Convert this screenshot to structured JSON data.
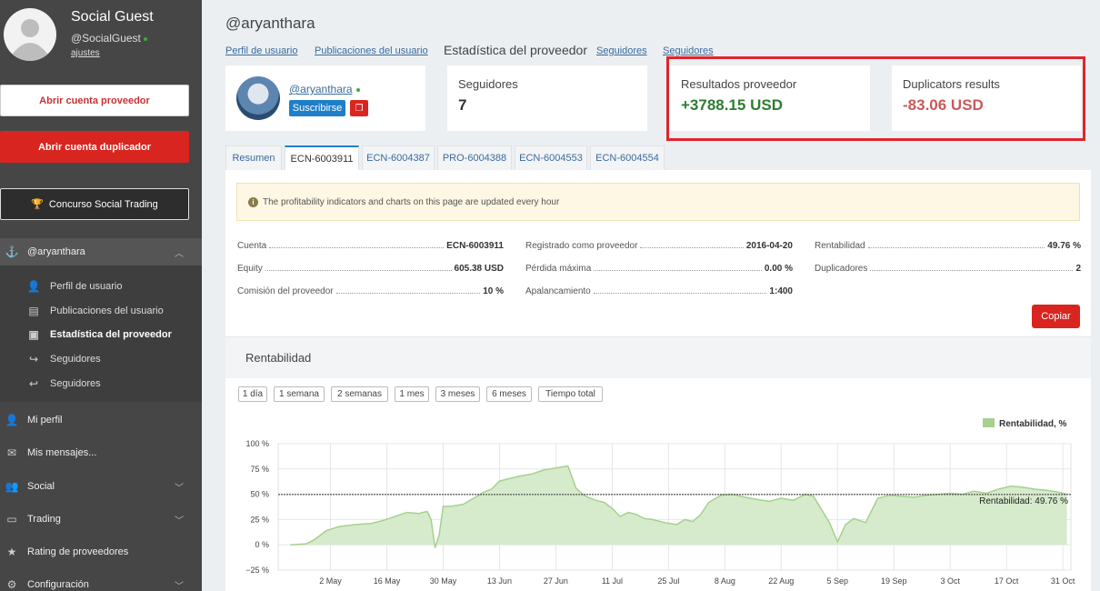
{
  "sidebar": {
    "user_name": "Social Guest",
    "user_handle": "@SocialGuest",
    "settings_link": "ajustes",
    "open_provider": "Abrir cuenta proveedor",
    "open_duplicator": "Abrir cuenta duplicador",
    "contest": "Concurso Social Trading",
    "user_section": "@aryanthara",
    "sub_items": [
      {
        "label": "Perfil de usuario",
        "icon": "user-icon"
      },
      {
        "label": "Publicaciones del usuario",
        "icon": "newspaper-icon"
      },
      {
        "label": "Estadística del proveedor",
        "icon": "briefcase-icon"
      },
      {
        "label": "Seguidores",
        "icon": "share-icon"
      },
      {
        "label": "Seguidores",
        "icon": "reply-icon"
      }
    ],
    "items": [
      {
        "label": "Mi perfil",
        "icon": "user-icon"
      },
      {
        "label": "Mis mensajes...",
        "icon": "envelope-icon"
      },
      {
        "label": "Social",
        "icon": "users-icon"
      },
      {
        "label": "Trading",
        "icon": "money-icon"
      },
      {
        "label": "Rating de proveedores",
        "icon": "star-icon"
      },
      {
        "label": "Configuración",
        "icon": "gear-icon"
      }
    ]
  },
  "header": {
    "title": "@aryanthara",
    "links": [
      "Perfil de usuario",
      "Publicaciones del usuario"
    ],
    "active": "Estadística del proveedor",
    "links_after": [
      "Seguidores",
      "Seguidores"
    ]
  },
  "cards": {
    "profile_handle": "@aryanthara",
    "subscribe": "Suscribirse",
    "followers_label": "Seguidores",
    "followers_value": "7",
    "results_label": "Resultados proveedor",
    "results_value": "+3788.15 USD",
    "dup_label": "Duplicators results",
    "dup_value": "-83.06 USD"
  },
  "tabs": [
    "Resumen",
    "ECN-6003911",
    "ECN-6004387",
    "PRO-6004388",
    "ECN-6004553",
    "ECN-6004554"
  ],
  "notice": "The profitability indicators and charts on this page are updated every hour",
  "stats": {
    "col1": [
      {
        "label": "Cuenta",
        "value": "ECN-6003911"
      },
      {
        "label": "Equity",
        "value": "605.38 USD"
      },
      {
        "label": "Comisión del proveedor",
        "value": "10 %"
      }
    ],
    "col2": [
      {
        "label": "Registrado como proveedor",
        "value": "2016-04-20"
      },
      {
        "label": "Pérdida máxima",
        "value": "0.00 %"
      },
      {
        "label": "Apalancamiento",
        "value": "1:400"
      }
    ],
    "col3": [
      {
        "label": "Rentabilidad",
        "value": "49.76 %"
      },
      {
        "label": "Duplicadores",
        "value": "2"
      }
    ]
  },
  "copy_button": "Copiar",
  "rent_title": "Rentabilidad",
  "ranges": [
    "1 día",
    "1 semana",
    "2 semanas",
    "1 mes",
    "3 meses",
    "6 meses",
    "Tiempo total"
  ],
  "chart_data": {
    "type": "area",
    "legend": "Rentabilidad, %",
    "annotation": "Rentabilidad: 49.76 %",
    "reference_value": 49.76,
    "ylim": [
      -25,
      100
    ],
    "yticks": [
      100,
      75,
      50,
      25,
      0,
      -25
    ],
    "ytick_labels": [
      "100 %",
      "75 %",
      "50 %",
      "25 %",
      "0 %",
      "−25 %"
    ],
    "xticks": [
      "2 May",
      "16 May",
      "30 May",
      "13 Jun",
      "27 Jun",
      "11 Jul",
      "25 Jul",
      "8 Aug",
      "22 Aug",
      "5 Sep",
      "19 Sep",
      "3 Oct",
      "17 Oct",
      "31 Oct"
    ],
    "x": [
      "2016-04-22",
      "2016-04-26",
      "2016-04-28",
      "2016-05-01",
      "2016-05-04",
      "2016-05-08",
      "2016-05-12",
      "2016-05-15",
      "2016-05-18",
      "2016-05-21",
      "2016-05-24",
      "2016-05-26",
      "2016-05-27",
      "2016-05-28",
      "2016-05-29",
      "2016-05-30",
      "2016-06-01",
      "2016-06-04",
      "2016-06-07",
      "2016-06-09",
      "2016-06-11",
      "2016-06-13",
      "2016-06-15",
      "2016-06-18",
      "2016-06-21",
      "2016-06-24",
      "2016-06-27",
      "2016-06-30",
      "2016-07-02",
      "2016-07-04",
      "2016-07-05",
      "2016-07-07",
      "2016-07-09",
      "2016-07-11",
      "2016-07-13",
      "2016-07-15",
      "2016-07-17",
      "2016-07-19",
      "2016-07-21",
      "2016-07-24",
      "2016-07-27",
      "2016-07-29",
      "2016-07-31",
      "2016-08-02",
      "2016-08-04",
      "2016-08-07",
      "2016-08-10",
      "2016-08-13",
      "2016-08-16",
      "2016-08-19",
      "2016-08-22",
      "2016-08-25",
      "2016-08-28",
      "2016-08-30",
      "2016-09-01",
      "2016-09-03",
      "2016-09-05",
      "2016-09-07",
      "2016-09-09",
      "2016-09-12",
      "2016-09-15",
      "2016-09-18",
      "2016-09-21",
      "2016-09-24",
      "2016-09-27",
      "2016-09-30",
      "2016-10-03",
      "2016-10-06",
      "2016-10-09",
      "2016-10-12",
      "2016-10-15",
      "2016-10-18",
      "2016-10-21",
      "2016-10-24",
      "2016-10-27",
      "2016-10-30",
      "2016-11-01"
    ],
    "values": [
      0,
      1,
      5,
      14,
      18,
      20,
      21,
      24,
      28,
      32,
      31,
      33,
      25,
      -3,
      10,
      38,
      38,
      40,
      47,
      52,
      55,
      63,
      65,
      68,
      70,
      74,
      76,
      78,
      56,
      49,
      47,
      44,
      42,
      36,
      28,
      32,
      30,
      26,
      25,
      22,
      20,
      25,
      23,
      30,
      42,
      49,
      50,
      47,
      45,
      43,
      46,
      44,
      50,
      48,
      35,
      22,
      3,
      20,
      26,
      22,
      46,
      49,
      48,
      47,
      49,
      50,
      51,
      50,
      53,
      51,
      55,
      58,
      57,
      55,
      54,
      52,
      50
    ]
  }
}
